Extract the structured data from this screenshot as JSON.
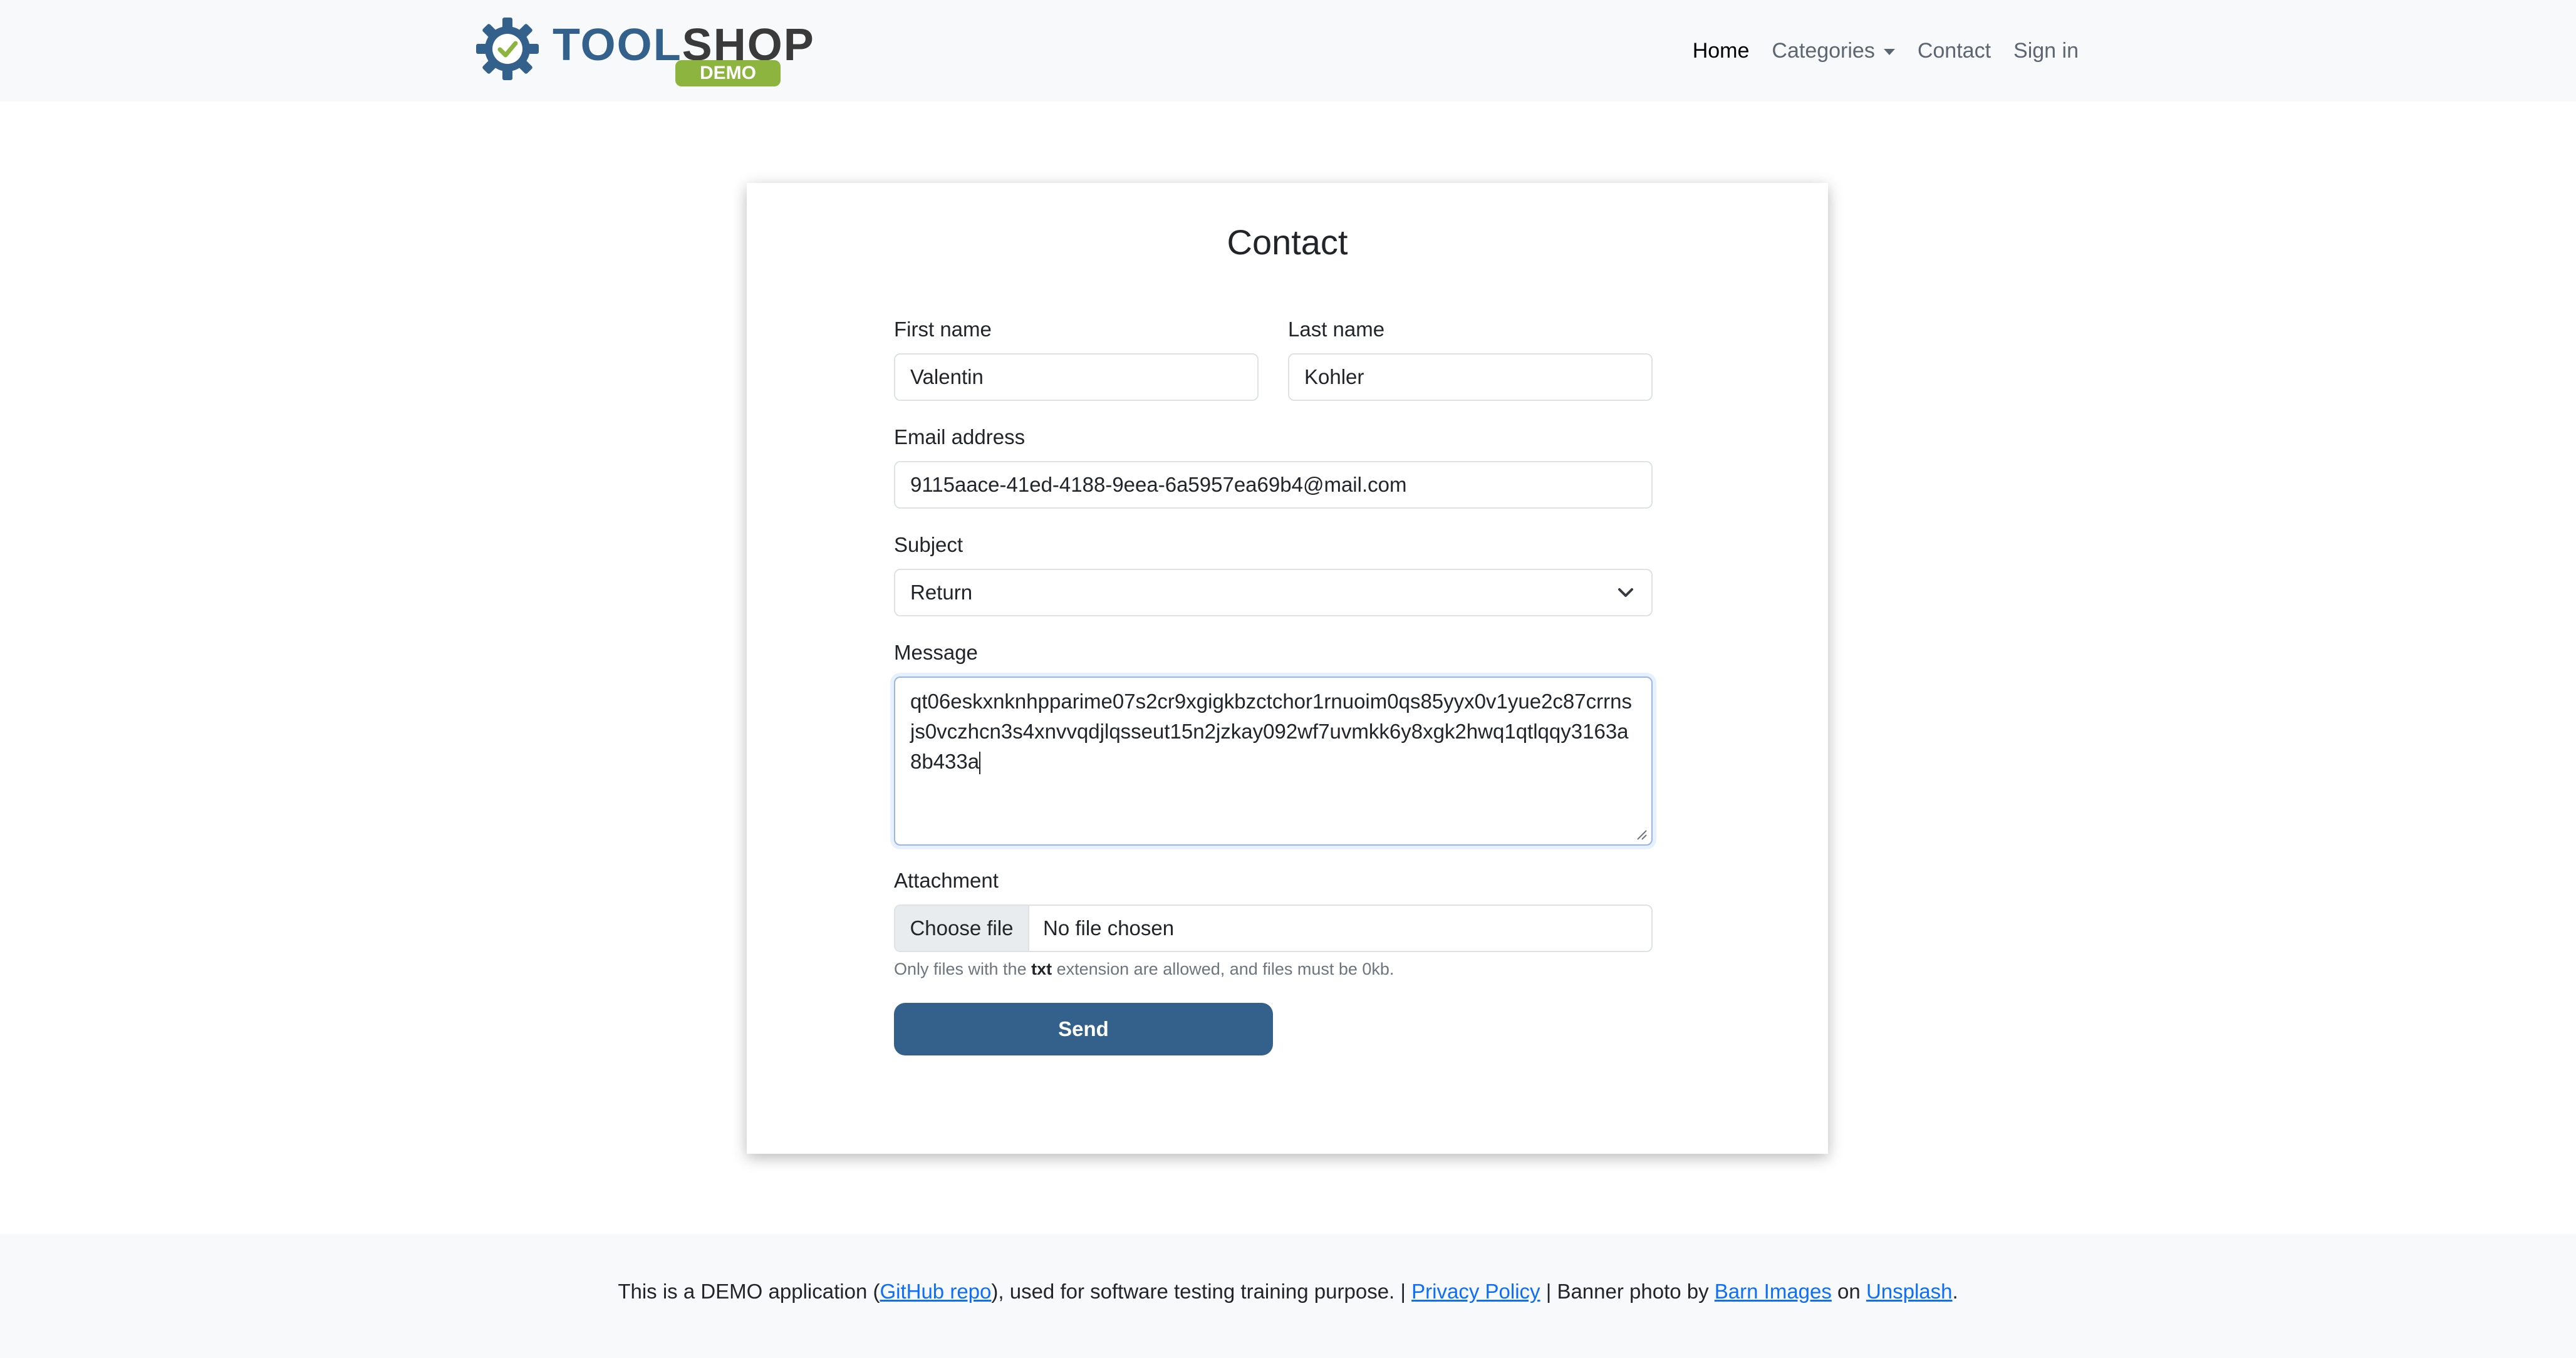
{
  "brand": {
    "logo_text_part1": "TOOL",
    "logo_text_part2": "SHOP",
    "logo_badge": "DEMO",
    "primary_color": "#33618c",
    "badge_color": "#8cb43f"
  },
  "nav": {
    "items": [
      {
        "label": "Home",
        "active": true
      },
      {
        "label": "Categories",
        "dropdown": true
      },
      {
        "label": "Contact"
      },
      {
        "label": "Sign in"
      }
    ]
  },
  "form": {
    "title": "Contact",
    "first_name": {
      "label": "First name",
      "value": "Valentin"
    },
    "last_name": {
      "label": "Last name",
      "value": "Kohler"
    },
    "email": {
      "label": "Email address",
      "value": "9115aace-41ed-4188-9eea-6a5957ea69b4@mail.com"
    },
    "subject": {
      "label": "Subject",
      "value": "Return"
    },
    "message": {
      "label": "Message",
      "value": "qt06eskxnknhpparime07s2cr9xgigkbzctchor1rnuoim0qs85yyx0v1yue2c87crrnsjs0vczhcn3s4xnvvqdjlqsseut15n2jzkay092wf7uvmkk6y8xgk2hwq1qtlqqy3163a8b433a"
    },
    "attachment": {
      "label": "Attachment",
      "button": "Choose file",
      "status": "No file chosen",
      "help_prefix": "Only files with the ",
      "help_ext": "txt",
      "help_suffix": " extension are allowed, and files must be 0kb."
    },
    "send_label": "Send"
  },
  "footer": {
    "t1": "This is a DEMO application (",
    "github": "GitHub repo",
    "t2": "), used for software testing training purpose. | ",
    "privacy": "Privacy Policy",
    "t3": " | Banner photo by ",
    "barn": "Barn Images",
    "t4": " on ",
    "unsplash": "Unsplash",
    "t5": "."
  }
}
